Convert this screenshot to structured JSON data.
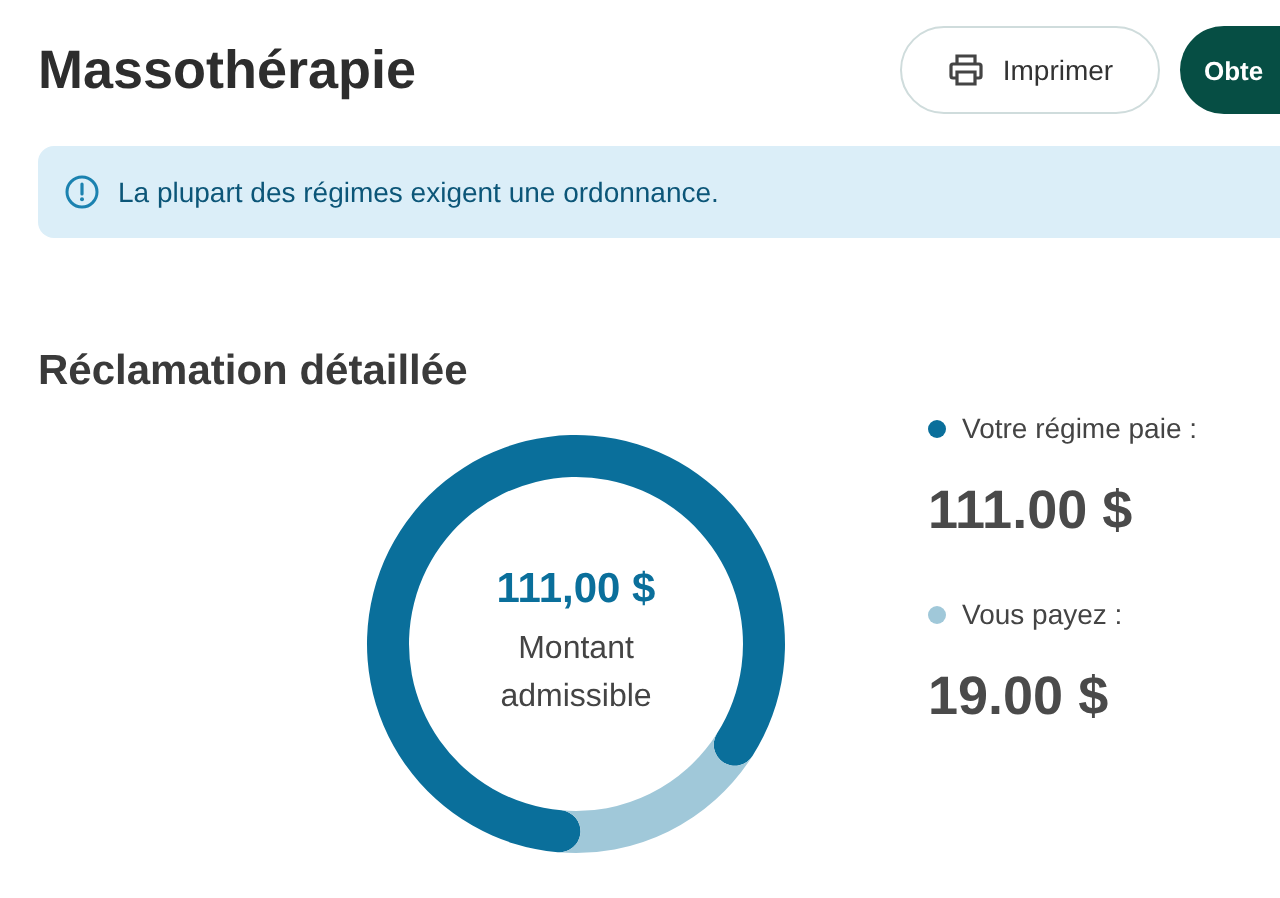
{
  "header": {
    "title": "Massothérapie",
    "buttons": [
      {
        "kind": "outline",
        "label": "Imprimer"
      },
      {
        "kind": "primary",
        "label": "Obte"
      }
    ]
  },
  "notice": {
    "text": "La plupart des régimes exigent une ordonnance."
  },
  "claim": {
    "title": "Réclamation détaillée",
    "center_amount": "111,00 $",
    "chart_data": {
      "type": "donut",
      "series": [
        {
          "name": "Montant admissible",
          "values": [
            85.4,
            14.6
          ]
        }
      ]
    },
    "legend": [
      {
        "label": "Votre régime paie :",
        "amount": "111.00 $",
        "color": "#0a6f9b"
      },
      {
        "label": "Vous payez :",
        "amount": "19.00 $",
        "color": "#a0c8d9"
      }
    ]
  }
}
